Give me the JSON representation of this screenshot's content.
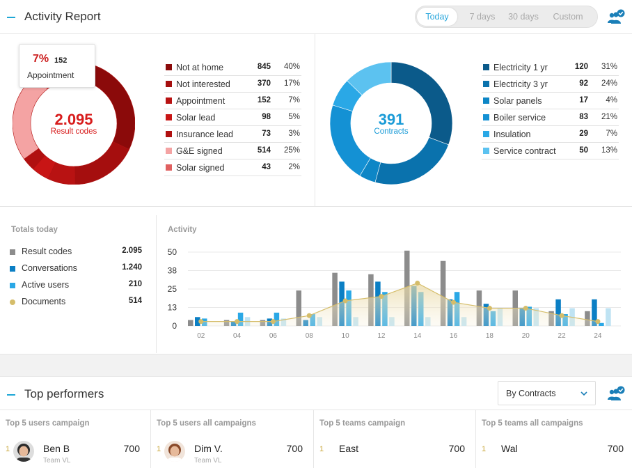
{
  "header": {
    "title": "Activity Report",
    "periods": [
      "Today",
      "7 days",
      "30 days",
      "Custom"
    ],
    "active_period": "Today"
  },
  "result_codes": {
    "total": "2.095",
    "total_label": "Result codes",
    "tooltip": {
      "percent": "7%",
      "count": "152",
      "name": "Appointment"
    },
    "items": [
      {
        "label": "Not at home",
        "value": "845",
        "percent": "40%",
        "color": "#8b0a0a"
      },
      {
        "label": "Not interested",
        "value": "370",
        "percent": "17%",
        "color": "#a50e0e"
      },
      {
        "label": "Appointment",
        "value": "152",
        "percent": "7%",
        "color": "#b81212"
      },
      {
        "label": "Solar lead",
        "value": "98",
        "percent": "5%",
        "color": "#c81515"
      },
      {
        "label": "Insurance lead",
        "value": "73",
        "percent": "3%",
        "color": "#b01010"
      },
      {
        "label": "G&E signed",
        "value": "514",
        "percent": "25%",
        "color": "#f4a3a3"
      },
      {
        "label": "Solar signed",
        "value": "43",
        "percent": "2%",
        "color": "#e06060"
      }
    ]
  },
  "contracts": {
    "total": "391",
    "total_label": "Contracts",
    "items": [
      {
        "label": "Electricity 1 yr",
        "value": "120",
        "percent": "31%",
        "color": "#0b5a8a"
      },
      {
        "label": "Electricity 3 yr",
        "value": "92",
        "percent": "24%",
        "color": "#0a72ad"
      },
      {
        "label": "Solar panels",
        "value": "17",
        "percent": "4%",
        "color": "#0d86c6"
      },
      {
        "label": "Boiler service",
        "value": "83",
        "percent": "21%",
        "color": "#1491d4"
      },
      {
        "label": "Insulation",
        "value": "29",
        "percent": "7%",
        "color": "#2aa8e6"
      },
      {
        "label": "Service contract",
        "value": "50",
        "percent": "13%",
        "color": "#5cc2f0"
      }
    ]
  },
  "totals": {
    "title": "Totals today",
    "items": [
      {
        "label": "Result codes",
        "value": "2.095",
        "color": "#8c8c8c",
        "shape": "square"
      },
      {
        "label": "Conversations",
        "value": "1.240",
        "color": "#0b7fc4",
        "shape": "square"
      },
      {
        "label": "Active users",
        "value": "210",
        "color": "#2aa8e6",
        "shape": "square"
      },
      {
        "label": "Documents",
        "value": "514",
        "color": "#d5bd6a",
        "shape": "circle"
      }
    ]
  },
  "chart_data": {
    "type": "bar",
    "title": "Activity",
    "y_ticks": [
      "50",
      "38",
      "25",
      "13",
      "0"
    ],
    "ylim": [
      0,
      50
    ],
    "x_tick_labels": [
      "02",
      "04",
      "06",
      "08",
      "10",
      "12",
      "14",
      "16",
      "18",
      "20",
      "22",
      "24"
    ],
    "grid": true,
    "series": [
      {
        "name": "Result codes",
        "color": "#8c8c8c",
        "values": [
          4,
          4,
          4,
          24,
          36,
          35,
          51,
          44,
          24,
          24,
          10,
          10
        ]
      },
      {
        "name": "Conversations",
        "color": "#0b7fc4",
        "values": [
          6,
          3,
          5,
          4,
          30,
          30,
          27,
          18,
          15,
          12,
          18,
          18
        ]
      },
      {
        "name": "Active users",
        "color": "#2aa8e6",
        "values": [
          5,
          9,
          9,
          8,
          24,
          23,
          23,
          23,
          10,
          13,
          8,
          2
        ]
      },
      {
        "name": "Documents (light)",
        "color": "#bfe3f3",
        "values": [
          0,
          6,
          5,
          6,
          6,
          6,
          6,
          6,
          12,
          12,
          12,
          12
        ]
      }
    ],
    "line": {
      "name": "Documents",
      "color": "#d5bd6a",
      "values": [
        3,
        3,
        3,
        7,
        17,
        20,
        29,
        16,
        12,
        12,
        7,
        3
      ]
    }
  },
  "performers": {
    "title": "Top performers",
    "dropdown": "By Contracts",
    "columns": [
      {
        "header": "Top 5 users campaign",
        "rank": "1",
        "name": "Ben B",
        "sub": "Team VL",
        "score": "700",
        "avatar": true
      },
      {
        "header": "Top 5 users all campaigns",
        "rank": "1",
        "name": "Dim V.",
        "sub": "Team VL",
        "score": "700",
        "avatar": true
      },
      {
        "header": "Top 5 teams campaign",
        "rank": "1",
        "name": "East",
        "sub": "",
        "score": "700",
        "avatar": false
      },
      {
        "header": "Top 5 teams all campaigns",
        "rank": "1",
        "name": "Wal",
        "sub": "",
        "score": "700",
        "avatar": false
      }
    ]
  }
}
